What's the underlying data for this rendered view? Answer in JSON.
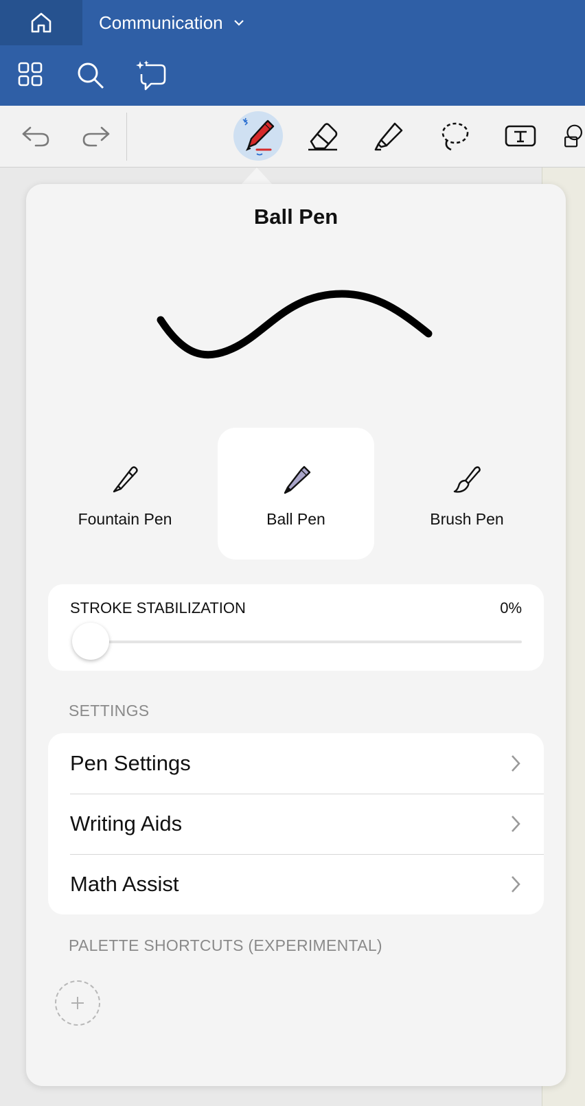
{
  "header": {
    "notebook_title": "Communication"
  },
  "popover": {
    "title": "Ball Pen",
    "pen_types": [
      {
        "label": "Fountain Pen",
        "selected": false
      },
      {
        "label": "Ball Pen",
        "selected": true
      },
      {
        "label": "Brush Pen",
        "selected": false
      }
    ],
    "stroke_stabilization": {
      "label": "STROKE STABILIZATION",
      "value_text": "0%",
      "value": 0
    },
    "settings_section_label": "SETTINGS",
    "settings_rows": [
      {
        "label": "Pen Settings"
      },
      {
        "label": "Writing Aids"
      },
      {
        "label": "Math Assist"
      }
    ],
    "palette_section_label": "PALETTE SHORTCUTS (EXPERIMENTAL)"
  },
  "colors": {
    "header_blue": "#2f5fa6",
    "active_tool_bg": "#cfe0f2",
    "pen_red": "#d62a2a",
    "ball_pen_lavender": "#a9a5c9"
  }
}
